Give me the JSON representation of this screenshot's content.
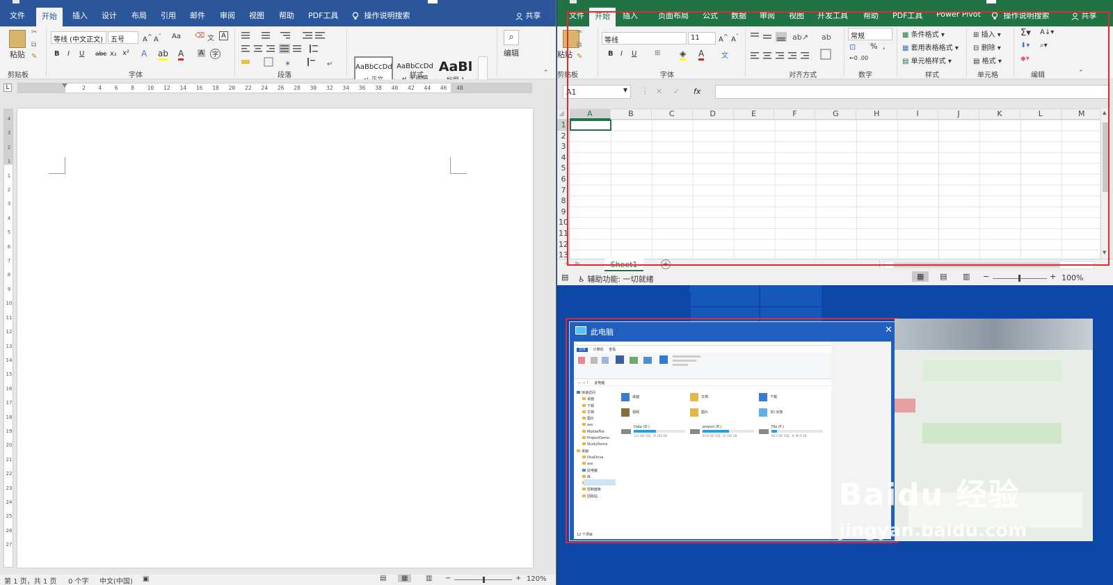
{
  "word": {
    "tabs": [
      "文件",
      "开始",
      "插入",
      "设计",
      "布局",
      "引用",
      "邮件",
      "审阅",
      "视图",
      "帮助",
      "PDF工具",
      "操作说明搜索",
      "共享"
    ],
    "clipboard": {
      "paste": "粘贴",
      "group": "剪贴板"
    },
    "font": {
      "name": "等线 (中文正文)",
      "size": "五号",
      "case": "Aa",
      "group": "字体",
      "bold": "B",
      "italic": "I",
      "underline": "U",
      "strike": "abc",
      "sub": "x₂",
      "sup": "x²"
    },
    "paragraph": {
      "group": "段落"
    },
    "styles": {
      "items": [
        {
          "sample": "AaBbCcDd",
          "name": "↵ 正文"
        },
        {
          "sample": "AaBbCcDd",
          "name": "↵ 无间隔"
        },
        {
          "sample": "AaBl",
          "name": "标题 1"
        }
      ],
      "group": "样式"
    },
    "editing": {
      "label": "编辑"
    },
    "ruler_marks": [
      "2",
      "4",
      "6",
      "8",
      "10",
      "12",
      "14",
      "16",
      "18",
      "20",
      "22",
      "24",
      "26",
      "28",
      "30",
      "32",
      "34",
      "36",
      "38",
      "40",
      "42",
      "44",
      "46",
      "48"
    ],
    "ruler_left_marks": [
      "4",
      "3",
      "2",
      "1",
      "",
      "1",
      "2",
      "3",
      "4",
      "5",
      "6",
      "7",
      "8",
      "9",
      "10",
      "11",
      "12",
      "13",
      "14",
      "15",
      "16",
      "17",
      "18",
      "19",
      "20",
      "21",
      "22",
      "23",
      "24",
      "25",
      "26",
      "27"
    ],
    "status": {
      "page": "第 1 页，共 1 页",
      "words": "0 个字",
      "lang": "中文(中国)",
      "zoom": "120%"
    }
  },
  "excel": {
    "tabs": [
      "文件",
      "开始",
      "插入",
      "页面布局",
      "公式",
      "数据",
      "审阅",
      "视图",
      "开发工具",
      "帮助",
      "PDF工具",
      "Power Pivot",
      "操作说明搜索",
      "共享"
    ],
    "clipboard": {
      "paste": "粘贴",
      "group": "剪贴板"
    },
    "font": {
      "name": "等线",
      "size": "11",
      "group": "字体",
      "bold": "B",
      "italic": "I",
      "underline": "U"
    },
    "align_group": "对齐方式",
    "number": {
      "format": "常规",
      "group": "数字"
    },
    "styles": {
      "items": [
        "条件格式",
        "套用表格格式",
        "单元格样式"
      ],
      "group": "样式"
    },
    "cells": {
      "items": [
        "插入",
        "删除",
        "格式"
      ],
      "group": "单元格"
    },
    "editing_group": "编辑",
    "name_box": "A1",
    "formula": "",
    "columns": [
      "A",
      "B",
      "C",
      "D",
      "E",
      "F",
      "G",
      "H",
      "I",
      "J",
      "K",
      "L",
      "M"
    ],
    "rows": [
      "1",
      "2",
      "3",
      "4",
      "5",
      "6",
      "7",
      "8",
      "9",
      "10",
      "11",
      "12",
      "13"
    ],
    "sheet": "Sheet1",
    "status": {
      "accessibility": "辅助功能: 一切就绪",
      "zoom": "100%"
    }
  },
  "explorer": {
    "title": "此电脑",
    "ribbon_tabs": [
      "文件",
      "计算机",
      "查看"
    ],
    "address": "此电脑",
    "nav": [
      "快速访问",
      "桌面",
      "下载",
      "文档",
      "图片",
      "ass",
      "MobileFile",
      "ProjectDemo",
      "StudyDemo",
      "桌面",
      "OneDrive",
      "ass",
      "此电脑",
      "库",
      "网络",
      "控制面板",
      "回收站"
    ],
    "folders": [
      "桌面",
      "文档",
      "下载",
      "视频",
      "图片",
      "3D 对象"
    ],
    "drives": [
      {
        "name": "Data (D:)",
        "free": "111 GB 可用，共 195 GB"
      },
      {
        "name": "project (E:)",
        "free": "93.8 GB 可用，共 195 GB"
      },
      {
        "name": "File (F:)",
        "free": "80.2 GB 可用，共 90.0 GB"
      }
    ],
    "status": "12 个项目"
  },
  "watermark": {
    "brand": "Baidu 经验",
    "url": "jingyan.baidu.com"
  },
  "colors": {
    "word": "#2b579a",
    "excel": "#217346",
    "highlight": "#e8262a"
  }
}
